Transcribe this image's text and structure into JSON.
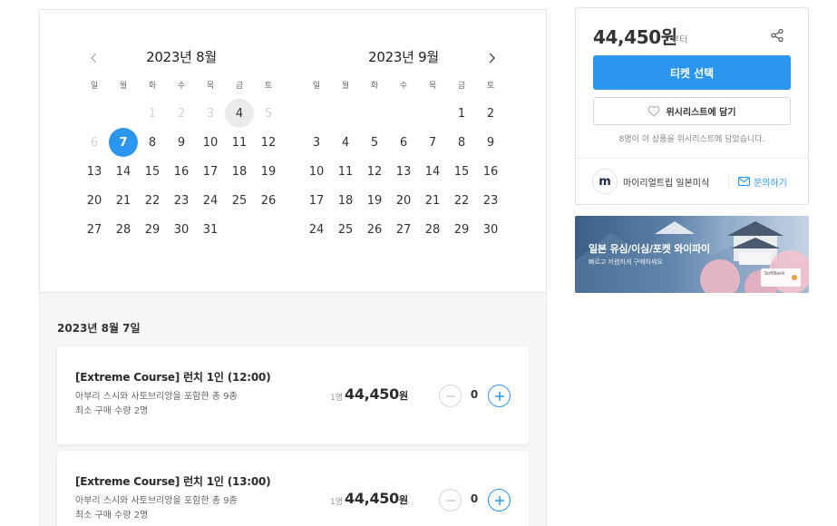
{
  "calendar": {
    "months": [
      {
        "title": "2023년 8월",
        "weekdays": [
          "일",
          "월",
          "화",
          "수",
          "목",
          "금",
          "토"
        ],
        "rows": [
          [
            "",
            "",
            "1",
            "2",
            "3",
            "4",
            "5"
          ],
          [
            "6",
            "7",
            "8",
            "9",
            "10",
            "11",
            "12"
          ],
          [
            "13",
            "14",
            "15",
            "16",
            "17",
            "18",
            "19"
          ],
          [
            "20",
            "21",
            "22",
            "23",
            "24",
            "25",
            "26"
          ],
          [
            "27",
            "28",
            "29",
            "30",
            "31",
            "",
            ""
          ]
        ],
        "disabled_days": [
          "1",
          "2",
          "3",
          "5",
          "6"
        ],
        "highlighted_day": "4",
        "selected_day": "7"
      },
      {
        "title": "2023년 9월",
        "weekdays": [
          "일",
          "월",
          "화",
          "수",
          "목",
          "금",
          "토"
        ],
        "rows": [
          [
            "",
            "",
            "",
            "",
            "",
            "1",
            "2"
          ],
          [
            "3",
            "4",
            "5",
            "6",
            "7",
            "8",
            "9"
          ],
          [
            "10",
            "11",
            "12",
            "13",
            "14",
            "15",
            "16"
          ],
          [
            "17",
            "18",
            "19",
            "20",
            "21",
            "22",
            "23"
          ],
          [
            "24",
            "25",
            "26",
            "27",
            "28",
            "29",
            "30"
          ]
        ],
        "disabled_days": [],
        "highlighted_day": "",
        "selected_day": ""
      }
    ]
  },
  "booking": {
    "date_label": "2023년 8월 7일",
    "tickets": [
      {
        "name": "[Extreme Course] 런치 1인 (12:00)",
        "desc1": "아부리 스시와 사토브리앙을 포함한 총 9종",
        "desc2": "최소 구매 수량 2명",
        "unit": "1명",
        "price": "44,450",
        "currency": "원",
        "quantity": "0"
      },
      {
        "name": "[Extreme Course] 런치 1인 (13:00)",
        "desc1": "아부리 스시와 사토브리앙을 포함한 총 9종",
        "desc2": "최소 구매 수량 2명",
        "unit": "1명",
        "price": "44,450",
        "currency": "원",
        "quantity": "0"
      }
    ]
  },
  "sidebar": {
    "price": "44,450원",
    "price_suffix": "부터",
    "select_button": "티켓 선택",
    "wishlist_button": "위시리스트에 담기",
    "wishlist_note": "8명이 이 상품을 위시리스트에 담았습니다.",
    "host_name": "마이리얼트립 일본미식",
    "inquiry_button": "문의하기",
    "share_icon": "share-icon",
    "heart_icon": "heart-icon",
    "mail_icon": "mail-icon"
  },
  "banner": {
    "title": "일본 유심/이심/포켓 와이파이",
    "subtitle": "빠르고 저렴하게 구매하세요",
    "brand": "SoftBank"
  },
  "colors": {
    "accent": "#2b96ed",
    "today_bg": "#ebebeb",
    "disabled_text": "#d4d4d4",
    "booking_bg": "#f5f6f8"
  }
}
